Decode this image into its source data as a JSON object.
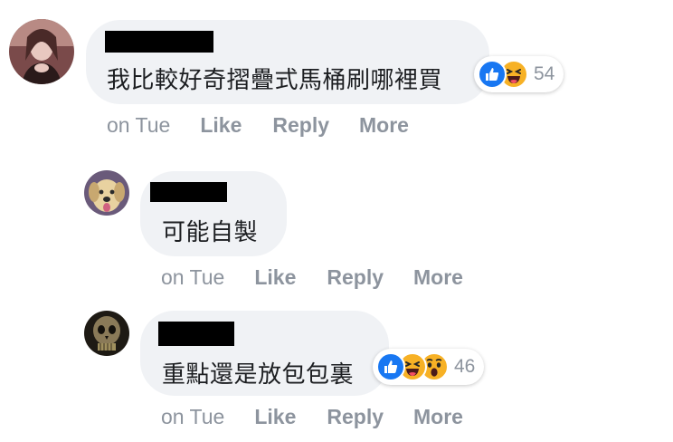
{
  "comments": [
    {
      "text": "我比較好奇摺疊式馬桶刷哪裡買",
      "reaction_icons": [
        "like-icon",
        "haha-icon"
      ],
      "reaction_count": "54",
      "time": "on Tue",
      "like_label": "Like",
      "reply_label": "Reply",
      "more_label": "More"
    },
    {
      "text": "可能自製",
      "time": "on Tue",
      "like_label": "Like",
      "reply_label": "Reply",
      "more_label": "More"
    },
    {
      "text": "重點還是放包包裏",
      "reaction_icons": [
        "like-icon",
        "haha-icon",
        "wow-icon"
      ],
      "reaction_count": "46",
      "time": "on Tue",
      "like_label": "Like",
      "reply_label": "Reply",
      "more_label": "More"
    }
  ],
  "colors": {
    "bubble_bg": "#f0f2f5",
    "text": "#1c1e21",
    "meta": "#8d949e",
    "like_blue": "#1877f2",
    "emoji_yellow": "#f7b125"
  }
}
